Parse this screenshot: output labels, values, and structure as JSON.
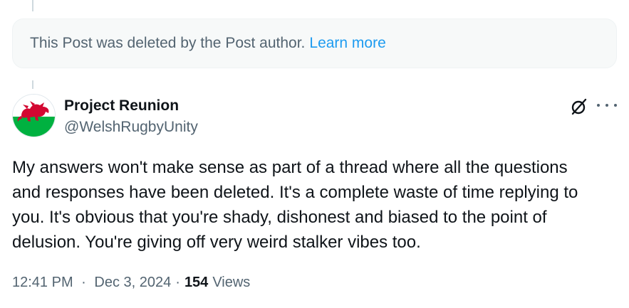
{
  "deleted_notice": {
    "text": "This Post was deleted by the Post author.",
    "link_label": "Learn more"
  },
  "post": {
    "author": {
      "display_name": "Project Reunion",
      "handle": "@WelshRugbyUnity",
      "avatar_icon": "welsh-flag-icon"
    },
    "text": "My answers won't make sense as part of a thread where all the questions\nand responses have been deleted. It's a complete waste of time replying to\nyou. It's obvious that you're shady, dishonest and biased to the point of\ndelusion. You're giving off very weird stalker vibes too.",
    "time": "12:41 PM",
    "date": "Dec 3, 2024",
    "separator": "·",
    "views_count": "154",
    "views_label": "Views"
  },
  "icons": {
    "grok": "grok-icon",
    "more": "more-icon"
  },
  "colors": {
    "link": "#1d9bf0",
    "secondary_text": "#536471",
    "primary_text": "#0f1419",
    "notice_bg": "#f7f9f9",
    "flag_green": "#00b140",
    "flag_red": "#d30731"
  }
}
